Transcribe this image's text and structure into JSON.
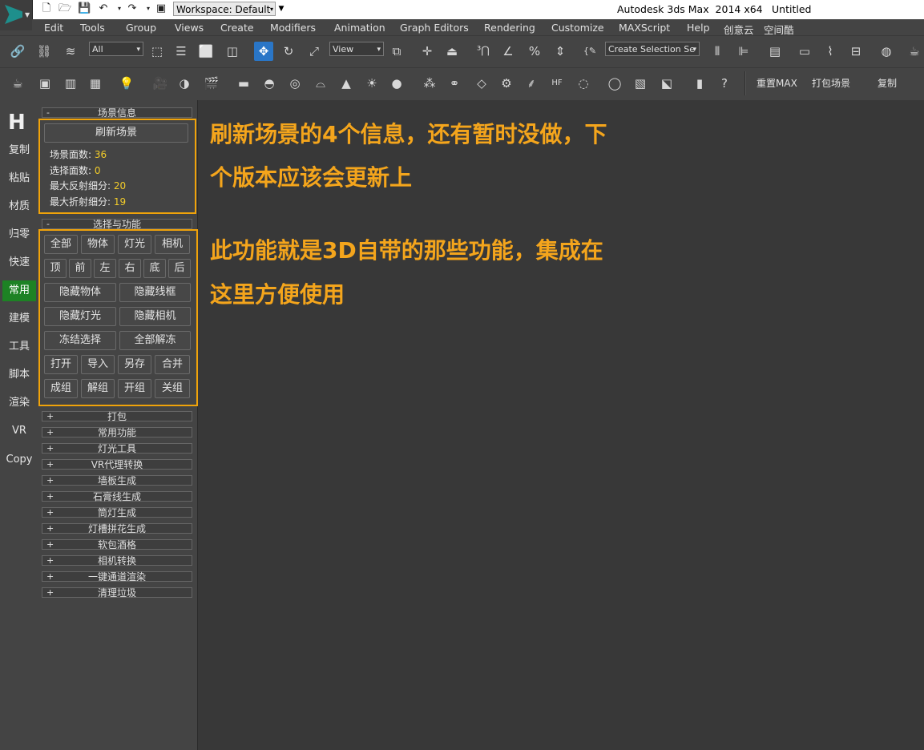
{
  "titlebar": {
    "workspace_label": "Workspace: Default",
    "app_title": "Autodesk 3ds Max  2014 x64",
    "doc_title": "Untitled"
  },
  "menu": [
    "Edit",
    "Tools",
    "Group",
    "Views",
    "Create",
    "Modifiers",
    "Animation",
    "Graph Editors",
    "Rendering",
    "Customize",
    "MAXScript",
    "Help",
    "创意云",
    "空间酷"
  ],
  "toolbar1": {
    "selection_filter": "All",
    "ref_coord": "View",
    "named_selection_placeholder": "Create Selection Se"
  },
  "toolbar2": {
    "buttons": [
      "重置MAX",
      "打包场景",
      "复制"
    ]
  },
  "left_tabs": {
    "logo": "H",
    "items": [
      "复制",
      "粘贴",
      "材质",
      "归零",
      "快速",
      "常用",
      "建模",
      "工具",
      "脚本",
      "渲染",
      "VR",
      "Copy"
    ],
    "active_index": 5
  },
  "panel": {
    "scene_info": {
      "header": "场景信息",
      "collapse_symbol": "-",
      "refresh_button": "刷新场景",
      "lines": [
        {
          "label": "场景面数:",
          "value": "36"
        },
        {
          "label": "选择面数:",
          "value": "0"
        },
        {
          "label": "最大反射细分:",
          "value": "20"
        },
        {
          "label": "最大折射细分:",
          "value": "19"
        }
      ]
    },
    "select_func": {
      "header": "选择与功能",
      "collapse_symbol": "-",
      "row1": [
        "全部",
        "物体",
        "灯光",
        "相机"
      ],
      "row2": [
        "顶",
        "前",
        "左",
        "右",
        "底",
        "后"
      ],
      "row3": [
        "隐藏物体",
        "隐藏线框"
      ],
      "row4": [
        "隐藏灯光",
        "隐藏相机"
      ],
      "row5": [
        "冻结选择",
        "全部解冻"
      ],
      "row6": [
        "打开",
        "导入",
        "另存",
        "合并"
      ],
      "row7": [
        "成组",
        "解组",
        "开组",
        "关组"
      ]
    },
    "collapsed_symbol": "+",
    "collapsed_rollouts": [
      "打包",
      "常用功能",
      "灯光工具",
      "VR代理转换",
      "墙板生成",
      "石膏线生成",
      "筒灯生成",
      "灯槽拼花生成",
      "软包酒格",
      "相机转换",
      "一键通道渲染",
      "清理垃圾"
    ]
  },
  "annotations": {
    "note1_line1": "刷新场景的4个信息，还有暂时没做，下",
    "note1_line2": "个版本应该会更新上",
    "note2_line1": "此功能就是3D自带的那些功能，集成在",
    "note2_line2": "这里方便使用"
  },
  "colors": {
    "highlight": "#f0a30a",
    "active_tab": "#1d8224",
    "info_value": "#f2cc2a",
    "annotation": "#f4a51c",
    "active_tool": "#2a76c7"
  }
}
